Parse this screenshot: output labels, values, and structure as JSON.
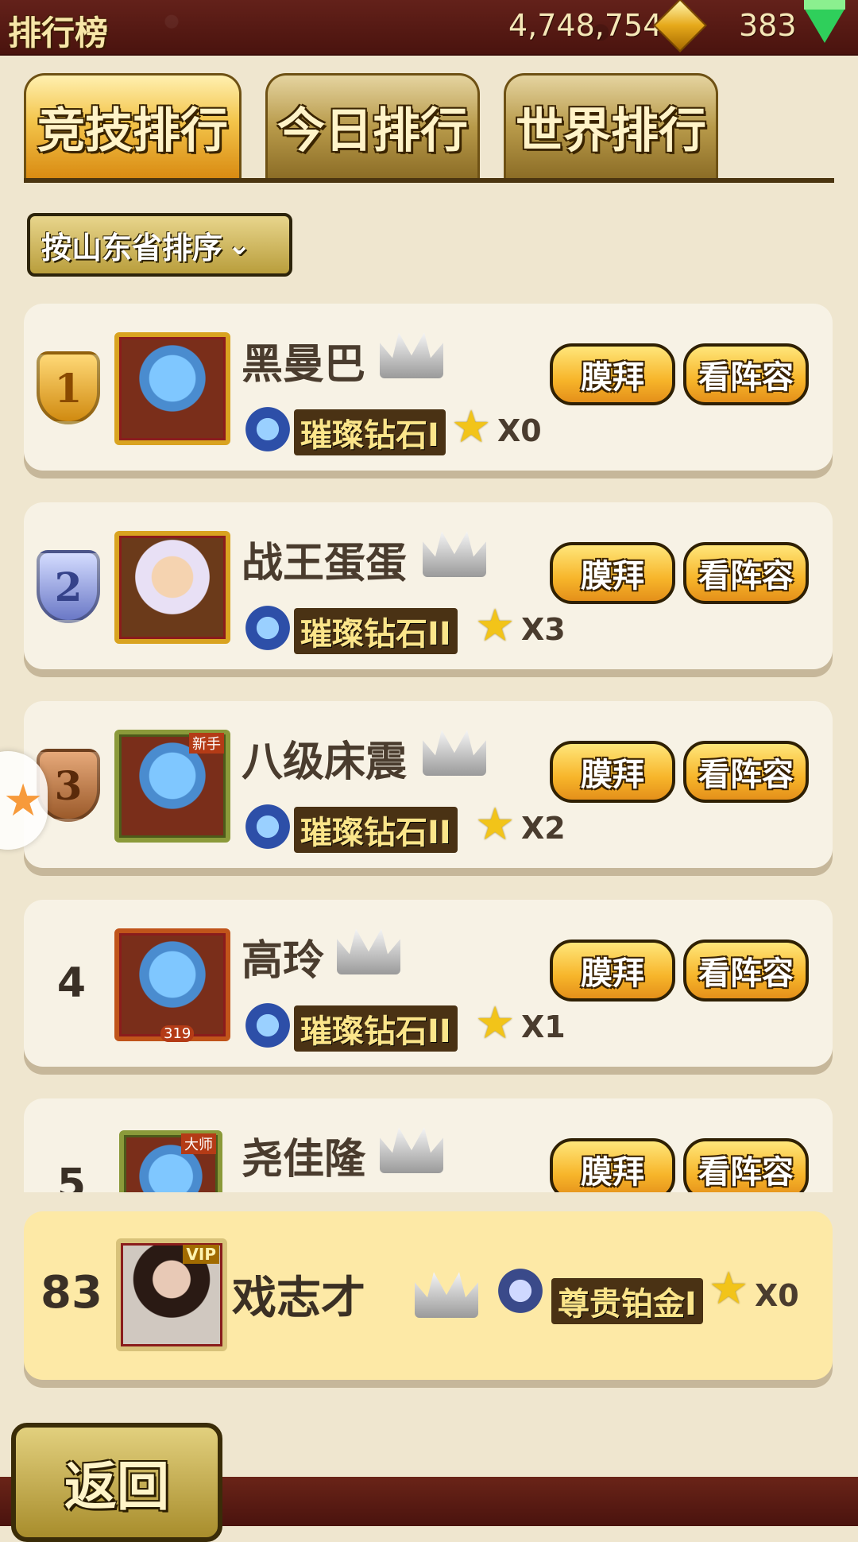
{
  "header": {
    "title": "排行榜",
    "gold": "4,748,754",
    "gems": "383"
  },
  "tabs": [
    "竞技排行",
    "今日排行",
    "世界排行"
  ],
  "sort_label": "按山东省排序",
  "buttons": {
    "worship": "膜拜",
    "lineup": "看阵容"
  },
  "rows": [
    {
      "rank": "1",
      "name": "黑曼巴",
      "tier": "璀璨钻石I",
      "stars": "X0"
    },
    {
      "rank": "2",
      "name": "战王蛋蛋",
      "tier": "璀璨钻石II",
      "stars": "X3"
    },
    {
      "rank": "3",
      "name": "八级床震",
      "tier": "璀璨钻石II",
      "stars": "X2",
      "tag": "新手"
    },
    {
      "rank": "4",
      "name": "高玲",
      "tier": "璀璨钻石II",
      "stars": "X1",
      "level": "319"
    },
    {
      "rank": "5",
      "name": "尧佳隆",
      "tag": "大师"
    }
  ],
  "self": {
    "rank": "83",
    "name": "戏志才",
    "tier": "尊贵铂金I",
    "stars": "X0",
    "vip": "VIP"
  },
  "back_label": "返回",
  "colors": {
    "accent": "#f7b52a",
    "topbar": "#5a1a14",
    "self_row": "#fde9a6"
  }
}
